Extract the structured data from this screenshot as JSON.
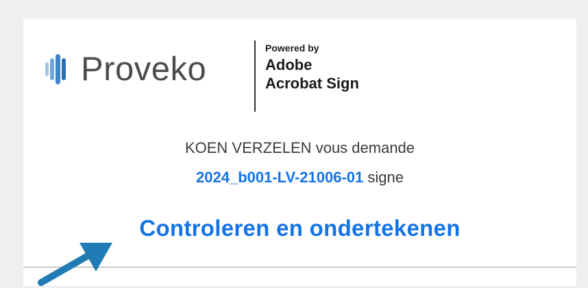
{
  "brand": {
    "logo_text": "Proveko",
    "powered_by_label": "Powered by",
    "product_line1": "Adobe",
    "product_line2": "Acrobat Sign"
  },
  "request": {
    "sender": "KOEN VERZELEN",
    "message": "vous demande",
    "document_name": "2024_b001-LV-21006-01",
    "suffix": "signe"
  },
  "action": {
    "review_and_sign_label": "Controleren en ondertekenen"
  },
  "colors": {
    "link_blue": "#1473e6",
    "logo_teal": "#3f86c9",
    "arrow_blue": "#1f7cb5"
  }
}
